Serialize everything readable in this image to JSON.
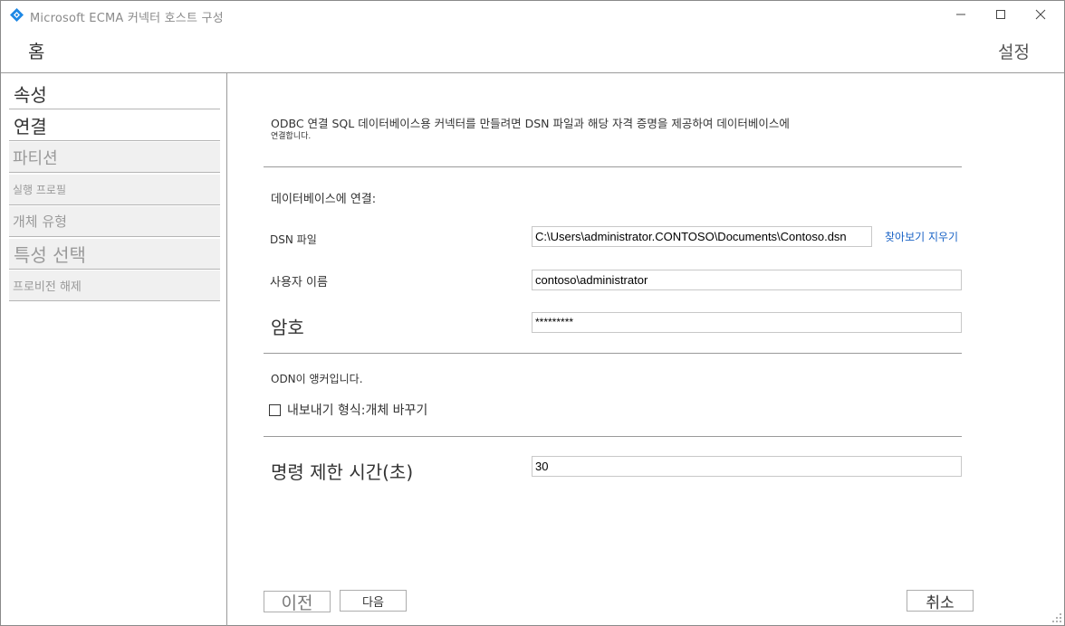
{
  "window": {
    "title": "Microsoft  ECMA 커넥터 호스트 구성",
    "controls": {
      "minimize": "—",
      "maximize": "☐",
      "close": "✕"
    }
  },
  "header": {
    "home": "홈",
    "settings": "설정"
  },
  "sidebar": {
    "items": [
      {
        "label": "속성",
        "state": "active"
      },
      {
        "label": "연결",
        "state": "active"
      },
      {
        "label": "파티션",
        "state": "inactive"
      },
      {
        "label": "실행 프로필",
        "state": "inactive"
      },
      {
        "label": "개체 유형",
        "state": "inactive"
      },
      {
        "label": "특성 선택",
        "state": "inactive"
      },
      {
        "label": "프로비전 해제",
        "state": "inactive"
      }
    ]
  },
  "main": {
    "intro_line1": "ODBC 연결 SQL 데이터베이스용 커넥터를 만들려면 DSN 파일과 해당 자격 증명을 제공하여 데이터베이스에",
    "intro_line2": "연결합니다.",
    "connect_heading": "데이터베이스에 연결:",
    "dsn": {
      "label": "DSN 파일",
      "value": "C:\\Users\\administrator.CONTOSO\\Documents\\Contoso.dsn",
      "link": "찾아보기 지우기"
    },
    "username": {
      "label": "사용자 이름",
      "value": "contoso\\administrator"
    },
    "password": {
      "label": "암호",
      "value": "*********"
    },
    "anchor_text": "ODN이 앵커입니다.",
    "export_checkbox": {
      "label": "내보내기 형식:개체 바꾸기",
      "checked": false
    },
    "timeout": {
      "label": "명령 제한 시간(초)",
      "value": "30"
    }
  },
  "footer": {
    "prev": "이전",
    "next": "다음",
    "cancel": "취소"
  },
  "colors": {
    "link": "#1a63c6",
    "app_icon": "#1e88e5",
    "inactive_nav_bg": "#f0f0f0"
  }
}
